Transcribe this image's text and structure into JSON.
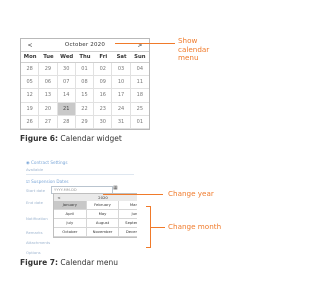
{
  "calendar": {
    "prev_arrow": "<",
    "month_year": "October 2020",
    "next_arrow": ">",
    "weekdays": [
      "Mon",
      "Tue",
      "Wed",
      "Thu",
      "Fri",
      "Sat",
      "Sun"
    ],
    "weeks": [
      [
        "28",
        "29",
        "30",
        "01",
        "02",
        "03",
        "04"
      ],
      [
        "05",
        "06",
        "07",
        "08",
        "09",
        "10",
        "11"
      ],
      [
        "12",
        "13",
        "14",
        "15",
        "16",
        "17",
        "18"
      ],
      [
        "19",
        "20",
        "21",
        "22",
        "23",
        "24",
        "25"
      ],
      [
        "26",
        "27",
        "28",
        "29",
        "30",
        "31",
        "01"
      ]
    ],
    "selected": "21"
  },
  "annotation_calendar": [
    "Show",
    "calendar",
    "menu"
  ],
  "figure6": {
    "label": "Figure 6:",
    "text": "Calendar widget"
  },
  "menu_shot": {
    "title": "Contract Settings",
    "subtitle": "Available",
    "section": "Suspension Dates",
    "start_label": "Start date",
    "start_placeholder": "YYYY-MM-DD",
    "calendar_icon": "calendar-icon",
    "left_label_1": "End date",
    "left_label_2": "Notification",
    "left_label_3": "Remarks",
    "left_label_4": "Attachments",
    "left_label_5": "Options",
    "prev": "<",
    "year": "2020",
    "next": ">",
    "months": [
      [
        "January",
        "February",
        "March"
      ],
      [
        "April",
        "May",
        "June"
      ],
      [
        "July",
        "August",
        "September"
      ],
      [
        "October",
        "November",
        "December"
      ]
    ],
    "selected_month": "January"
  },
  "annotation_year": "Change year",
  "annotation_month": "Change month",
  "figure7": {
    "label": "Figure 7:",
    "text": "Calendar menu"
  },
  "colors": {
    "accent": "#f07a2a",
    "selected": "#c9c9c9"
  }
}
